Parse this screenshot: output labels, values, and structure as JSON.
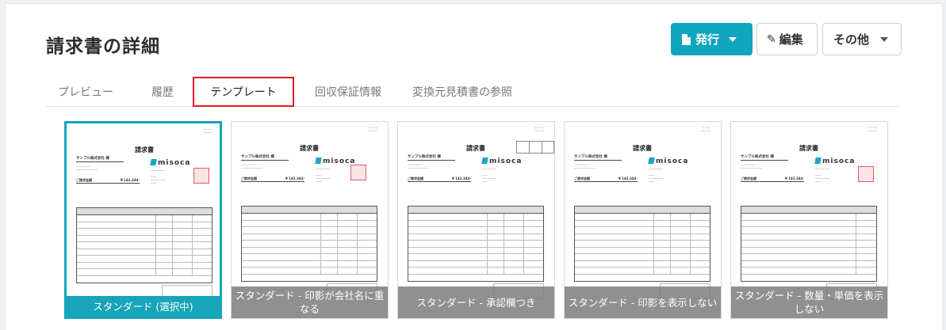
{
  "page": {
    "title": "請求書の詳細"
  },
  "toolbar": {
    "issue_label": "発行",
    "edit_label": "編集",
    "more_label": "その他"
  },
  "tabs": [
    {
      "label": "プレビュー",
      "active": false
    },
    {
      "label": "履歴",
      "active": false
    },
    {
      "label": "テンプレート",
      "active": true
    },
    {
      "label": "回収保証情報",
      "active": false
    },
    {
      "label": "変換元見積書の参照",
      "active": false
    }
  ],
  "preview": {
    "doc_title": "請求書",
    "customer": "サンプル株式会社 様",
    "logo_text": "misoca",
    "amount_label": "ご請求金額",
    "amount_value": "¥ 142,344-"
  },
  "templates": [
    {
      "caption": "スタンダード (選択中)",
      "selected": true
    },
    {
      "caption": "スタンダード - 印影が会社名に重なる",
      "selected": false
    },
    {
      "caption": "スタンダード - 承認欄つき",
      "selected": false
    },
    {
      "caption": "スタンダード - 印影を表示しない",
      "selected": false
    },
    {
      "caption": "スタンダード - 数量・単価を表示しない",
      "selected": false
    }
  ],
  "colors": {
    "accent": "#17a5b9",
    "highlight": "#e01b24"
  }
}
